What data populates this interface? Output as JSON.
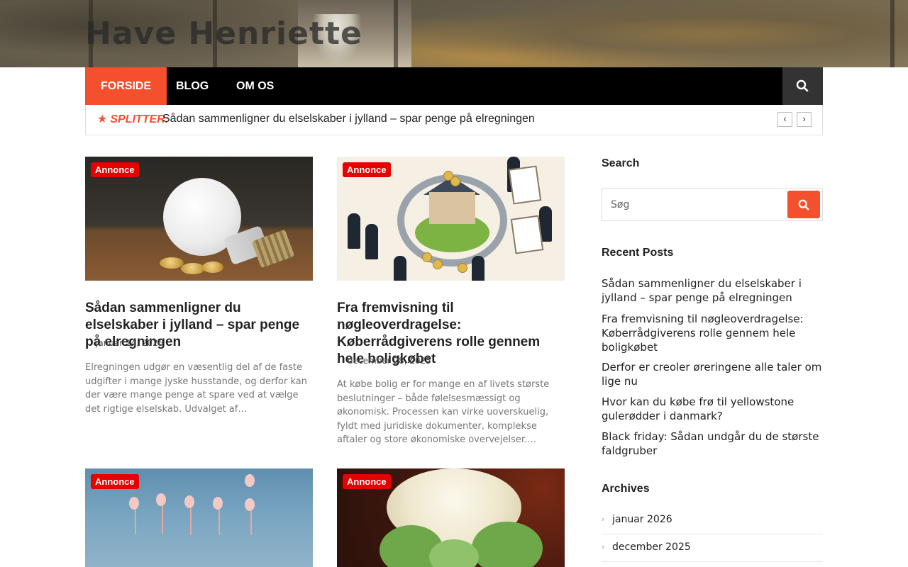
{
  "site": {
    "title": "Have Henriette"
  },
  "nav": {
    "items": [
      {
        "label": "FORSIDE",
        "active": true
      },
      {
        "label": "BLOG",
        "active": false
      },
      {
        "label": "OM OS",
        "active": false
      }
    ],
    "search_icon": "search-icon"
  },
  "ticker": {
    "label": "SPLITTER:",
    "text": "Sådan sammenligner du elselskaber i jylland – spar penge på elregningen",
    "prev": "‹",
    "next": "›"
  },
  "posts": [
    {
      "badge": "Annonce",
      "title": "Sådan sammenligner du elselskaber i jylland – spar penge på elregningen",
      "date": "januar 14, 2026",
      "excerpt": "Elregningen udgør en væsentlig del af de faste udgifter i mange jyske husstande, og derfor kan der være mange penge at spare ved at vælge det rigtige elselskab. Udvalget af…"
    },
    {
      "badge": "Annonce",
      "title": "Fra fremvisning til nøgleoverdragelse: Køberrådgiverens rolle gennem hele boligkøbet",
      "date": "december 28, 2025",
      "excerpt": "At købe bolig er for mange en af livets største beslutninger – både følelsesmæssigt og økonomisk. Processen kan virke uoverskuelig, fyldt med juridiske dokumenter, komplekse aftaler og store økonomiske overvejelser.…"
    },
    {
      "badge": "Annonce"
    },
    {
      "badge": "Annonce"
    }
  ],
  "sidebar": {
    "search": {
      "title": "Search",
      "placeholder": "Søg"
    },
    "recent": {
      "title": "Recent Posts",
      "items": [
        "Sådan sammenligner du elselskaber i jylland – spar penge på elregningen",
        "Fra fremvisning til nøgleoverdragelse: Køberrådgiverens rolle gennem hele boligkøbet",
        "Derfor er creoler øreringene alle taler om lige nu",
        "Hvor kan du købe frø til yellowstone gulerødder i danmark?",
        "Black friday: Sådan undgår du de største faldgruber"
      ]
    },
    "archives": {
      "title": "Archives",
      "items": [
        "januar 2026",
        "december 2025"
      ]
    }
  },
  "colors": {
    "accent": "#f4502e",
    "badge": "#e60000",
    "nav_bg": "#000000"
  }
}
